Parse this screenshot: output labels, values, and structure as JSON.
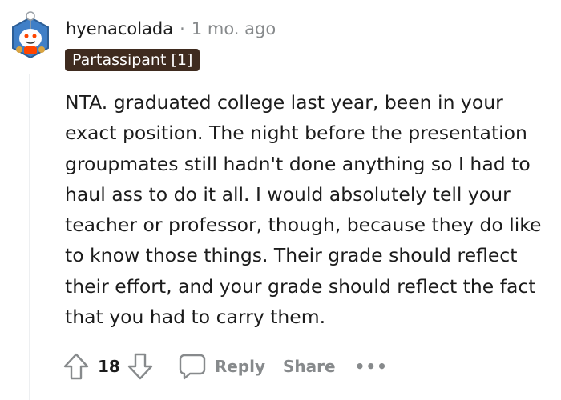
{
  "comment": {
    "username": "hyenacolada",
    "separator": "·",
    "timestamp": "1 mo. ago",
    "flair": "Partassipant [1]",
    "flair_color": "#3f2b1f",
    "avatar_icon": "snoo-avatar-icon",
    "text": "NTA. graduated college last year, been in your exact position. The night before the presentation groupmates still hadn't done anything so I had to haul ass to do it all. I would absolutely tell your teacher or professor, though, because they do like to know those things. Their grade should reflect their effort, and your grade should reflect the fact that you had to carry them."
  },
  "actions": {
    "upvote_icon": "upvote-arrow-icon",
    "vote_count": "18",
    "downvote_icon": "downvote-arrow-icon",
    "reply_icon": "speech-bubble-icon",
    "reply_label": "Reply",
    "share_label": "Share",
    "more_label": "•••"
  }
}
